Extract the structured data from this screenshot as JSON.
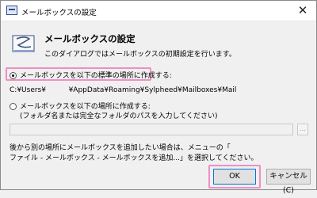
{
  "window": {
    "title": "メールボックスの設定",
    "close_glyph": "✕"
  },
  "header": {
    "title": "メールボックスの設定",
    "description": "このダイアログではメールボックスの初期設定を行います。",
    "icon": "mailbox-icon"
  },
  "options": {
    "default": {
      "label": "メールボックスを以下の標準の場所に作成する:",
      "checked": true,
      "path": "C:¥Users¥          ¥AppData¥Roaming¥Sylpheed¥Mailboxes¥Mail"
    },
    "custom": {
      "label_line1": "メールボックスを以下の場所に作成する:",
      "label_line2": "(フォルダ名または完全なフォルダのパスを入力してください)",
      "checked": false,
      "path_value": "",
      "browse_label": "..."
    }
  },
  "note": {
    "line1": "後から別の場所にメールボックスを追加したい場合は、メニューの「",
    "line2": "ファイル - メールボックス - メールボックスを追加...」を選択してください。"
  },
  "buttons": {
    "ok": "OK",
    "cancel": "キャンセル(C)"
  },
  "colors": {
    "highlight": "#ee8fc4",
    "ok_border": "#0078d7"
  }
}
